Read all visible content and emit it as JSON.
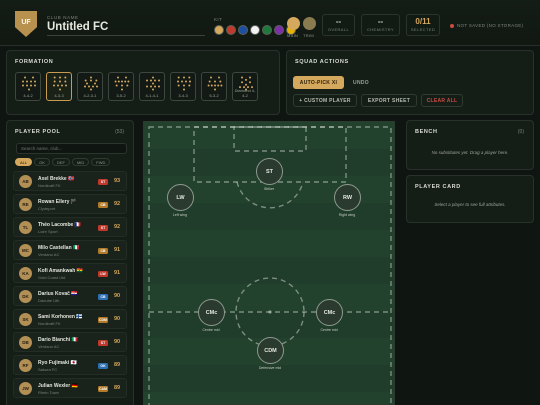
{
  "header": {
    "crest_text": "UF",
    "club_label": "CLUB NAME",
    "club_name": "Untitled FC",
    "kit_label": "KIT",
    "kit_swatches": [
      "#d4a85d",
      "#c0392b",
      "#1e4ea1",
      "#f2f2f2",
      "#1f7a3a",
      "#7d2fa6",
      "#e6b400"
    ],
    "main_label": "MAIN",
    "trim_label": "TRIM",
    "main_color": "#d4a85d",
    "trim_color": "#8a7a50",
    "overall_value": "--",
    "overall_label": "OVERALL",
    "chemistry_value": "--",
    "chemistry_label": "CHEMISTRY",
    "selected_value": "0/11",
    "selected_label": "SELECTED",
    "save_status": "NOT SAVED (NO STORAGE)"
  },
  "formation_panel": {
    "title": "FORMATION",
    "items": [
      {
        "label": "4-4-2",
        "rows": [
          4,
          4,
          2
        ]
      },
      {
        "label": "4-3-3",
        "rows": [
          4,
          3,
          3
        ]
      },
      {
        "label": "4-2-3-1",
        "rows": [
          4,
          2,
          3,
          1
        ]
      },
      {
        "label": "3-5-2",
        "rows": [
          3,
          5,
          2
        ]
      },
      {
        "label": "4-1-4-1",
        "rows": [
          4,
          1,
          4,
          1
        ]
      },
      {
        "label": "3-4-3",
        "rows": [
          3,
          4,
          3
        ]
      },
      {
        "label": "5-3-2",
        "rows": [
          5,
          3,
          2
        ]
      },
      {
        "label": "Diamond 4-4-2",
        "rows": [
          4,
          1,
          2,
          1,
          2
        ]
      }
    ],
    "active_index": 1
  },
  "squad_actions": {
    "title": "SQUAD ACTIONS",
    "auto_pick": "AUTO-PICK XI",
    "undo": "UNDO",
    "custom_player": "+ CUSTOM PLAYER",
    "export_sheet": "EXPORT SHEET",
    "clear_all": "CLEAR ALL"
  },
  "player_pool": {
    "title": "PLAYER POOL",
    "count": "(53)",
    "search_placeholder": "Search name, club...",
    "filters": [
      "ALL",
      "GK",
      "DEF",
      "MID",
      "FWD"
    ],
    "active_filter": 0,
    "players": [
      {
        "initials": "AB",
        "name": "Axel Brekke",
        "flag": "🇳🇴",
        "club": "Nordkraft FK",
        "pos": "ST",
        "rating": "93",
        "pos_color": "#c0392b"
      },
      {
        "initials": "RE",
        "name": "Rowan Ellery",
        "flag": "🏴",
        "club": "Clydeport",
        "pos": "CB",
        "rating": "92",
        "pos_color": "#b07a2a"
      },
      {
        "initials": "TL",
        "name": "Théo Lacombe",
        "flag": "🇫🇷",
        "club": "Loire Sport",
        "pos": "ST",
        "rating": "92",
        "pos_color": "#c0392b"
      },
      {
        "initials": "MC",
        "name": "Milo Castellan",
        "flag": "🇮🇹",
        "club": "Verdano AC",
        "pos": "CB",
        "rating": "91",
        "pos_color": "#b07a2a"
      },
      {
        "initials": "KA",
        "name": "Kofi Amankwah",
        "flag": "🇬🇭",
        "club": "Gold Coast Utd",
        "pos": "LW",
        "rating": "91",
        "pos_color": "#c0392b"
      },
      {
        "initials": "DK",
        "name": "Darius Kovač",
        "flag": "🇭🇷",
        "club": "Danube Uth",
        "pos": "CB",
        "rating": "90",
        "pos_color": "#2d6fb3"
      },
      {
        "initials": "SK",
        "name": "Sami Korhonen",
        "flag": "🇫🇮",
        "club": "Nordkraft FK",
        "pos": "CDM",
        "rating": "90",
        "pos_color": "#b07a2a"
      },
      {
        "initials": "DB",
        "name": "Dario Bianchi",
        "flag": "🇮🇹",
        "club": "Verdano AC",
        "pos": "ST",
        "rating": "90",
        "pos_color": "#c0392b"
      },
      {
        "initials": "RF",
        "name": "Ryo Fujimaki",
        "flag": "🇯🇵",
        "club": "Sakura FC",
        "pos": "GK",
        "rating": "89",
        "pos_color": "#2d6fb3"
      },
      {
        "initials": "JW",
        "name": "Julian Wexler",
        "flag": "🇩🇪",
        "club": "Rhein Town",
        "pos": "CAM",
        "rating": "89",
        "pos_color": "#b07a2a"
      }
    ]
  },
  "pitch": {
    "slots": [
      {
        "pos": "ST",
        "caption": "Striker"
      },
      {
        "pos": "LW",
        "caption": "Left wing"
      },
      {
        "pos": "RW",
        "caption": "Right wing"
      },
      {
        "pos": "CMc",
        "caption": "Centre mid"
      },
      {
        "pos": "CMc",
        "caption": "Centre mid"
      },
      {
        "pos": "CDM",
        "caption": "Defensive mid"
      }
    ]
  },
  "bench": {
    "title": "BENCH",
    "count": "(0)",
    "empty_text": "No substitutes yet. Drag a player here."
  },
  "player_card": {
    "title": "PLAYER CARD",
    "empty_text": "Select a player to see full attributes."
  }
}
